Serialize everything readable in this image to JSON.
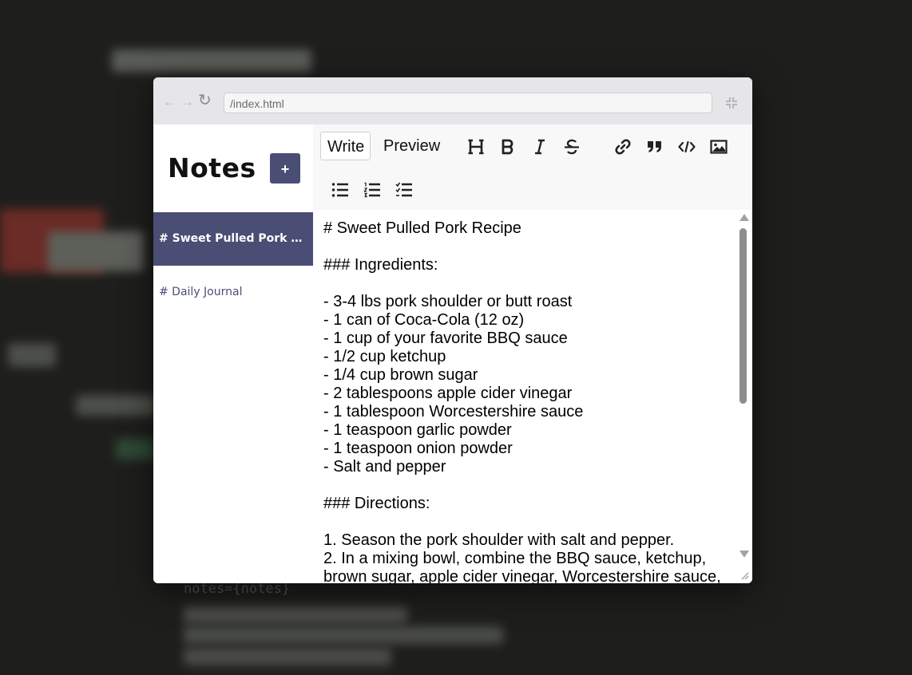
{
  "backdrop": {
    "code_notes": "notes={notes}"
  },
  "browser": {
    "back_icon": "arrow-left-icon",
    "forward_icon": "arrow-right-icon",
    "reload_icon": "reload-icon",
    "url": "/index.html",
    "collapse_icon": "collapse-icon"
  },
  "sidebar": {
    "title": "Notes",
    "add_label": "+",
    "notes": [
      {
        "label": "# Sweet Pulled Pork Re...",
        "active": true
      },
      {
        "label": "# Daily Journal",
        "active": false
      }
    ]
  },
  "editor": {
    "tabs": {
      "write": "Write",
      "preview": "Preview"
    },
    "tools": [
      "heading-icon",
      "bold-icon",
      "italic-icon",
      "strikethrough-icon",
      "link-icon",
      "quote-icon",
      "code-icon",
      "image-icon",
      "unordered-list-icon",
      "ordered-list-icon",
      "checklist-icon"
    ],
    "content": "# Sweet Pulled Pork Recipe\n\n### Ingredients:\n\n- 3-4 lbs pork shoulder or butt roast\n- 1 can of Coca-Cola (12 oz)\n- 1 cup of your favorite BBQ sauce\n- 1/2 cup ketchup\n- 1/4 cup brown sugar\n- 2 tablespoons apple cider vinegar\n- 1 tablespoon Worcestershire sauce\n- 1 teaspoon garlic powder\n- 1 teaspoon onion powder\n- Salt and pepper\n\n### Directions:\n\n1. Season the pork shoulder with salt and pepper.\n2. In a mixing bowl, combine the BBQ sauce, ketchup, brown sugar, apple cider vinegar, Worcestershire sauce,"
  },
  "colors": {
    "accent": "#4a4e74",
    "backdrop": "#1e1f1d"
  }
}
